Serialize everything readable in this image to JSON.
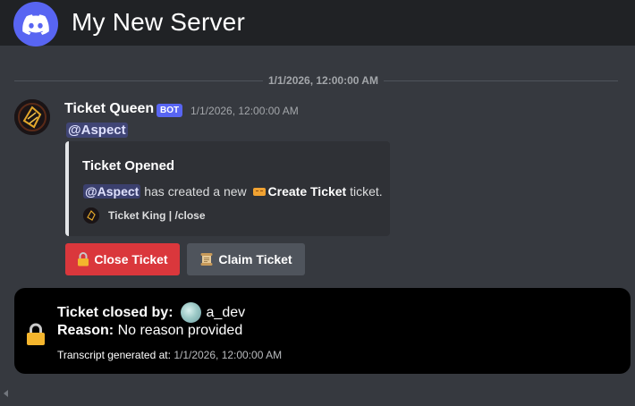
{
  "header": {
    "server_name": "My New Server",
    "logo_icon": "discord-logo-icon",
    "brand_color": "#5865f2"
  },
  "divider": {
    "date_label": "1/1/2026, 12:00:00 AM"
  },
  "message": {
    "author": "Ticket Queen",
    "bot_tag": "BOT",
    "timestamp": "1/1/2026, 12:00:00 AM",
    "mention": "@Aspect",
    "embed": {
      "title": "Ticket Opened",
      "desc_mention": "@Aspect",
      "desc_text_1": "has created a new",
      "desc_bold": "Create Ticket",
      "desc_text_2": "ticket.",
      "footer_text": "Ticket King | /close"
    },
    "buttons": [
      {
        "label": "Close Ticket",
        "icon": "lock-icon",
        "color": "#da373c"
      },
      {
        "label": "Claim Ticket",
        "icon": "scroll-icon",
        "color": "#4f545c"
      }
    ]
  },
  "closed": {
    "closed_by_label": "Ticket closed by:",
    "closed_by_user": "a_dev",
    "reason_label": "Reason:",
    "reason_value": "No reason provided",
    "transcript_label": "Transcript generated at:",
    "transcript_time": "1/1/2026, 12:00:00 AM"
  }
}
